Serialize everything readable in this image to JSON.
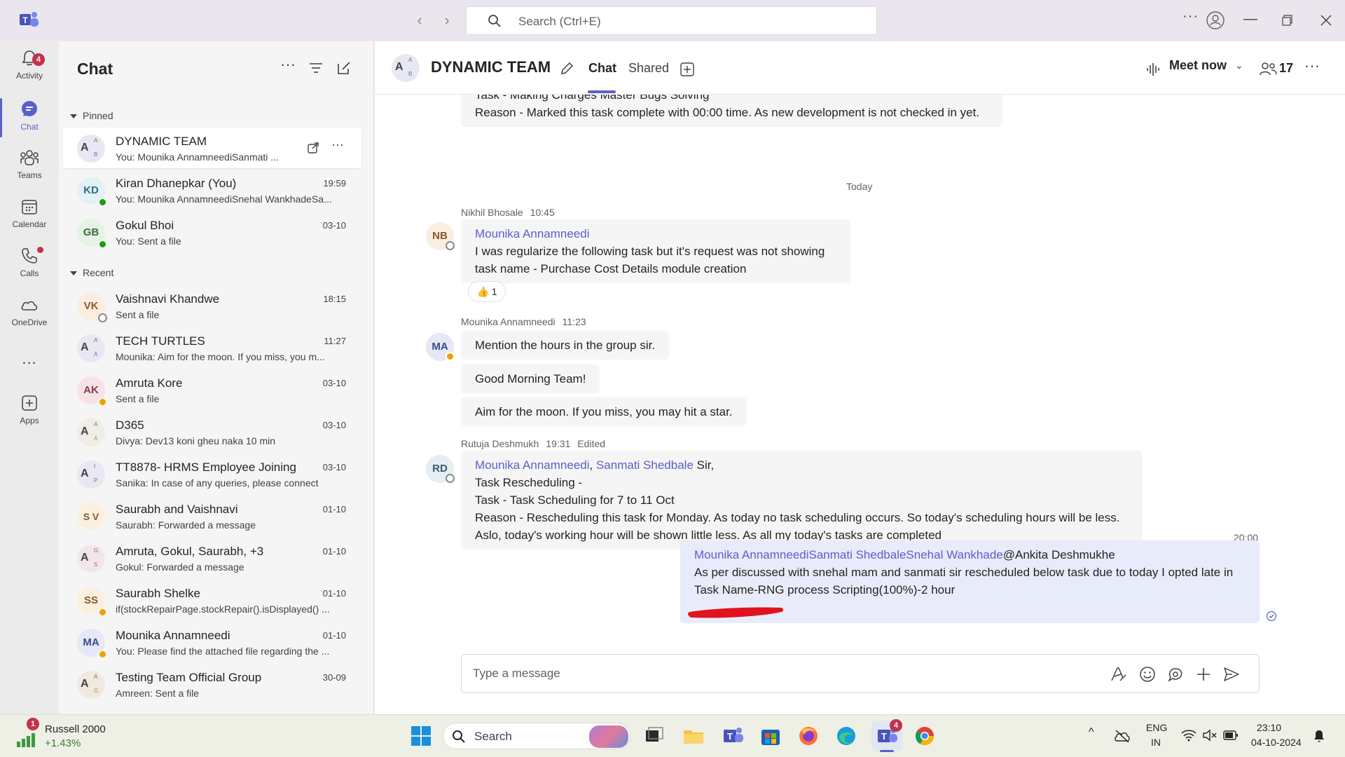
{
  "titlebar": {
    "search_placeholder": "Search (Ctrl+E)",
    "icons": [
      "teams-logo-icon",
      "back-icon",
      "forward-icon",
      "search-icon",
      "more-icon",
      "profile-icon",
      "minimize-icon",
      "maximize-icon",
      "close-icon"
    ]
  },
  "rail": {
    "items": [
      {
        "label": "Activity",
        "icon": "bell-icon",
        "badge": "4"
      },
      {
        "label": "Chat",
        "icon": "chat-icon"
      },
      {
        "label": "Teams",
        "icon": "teams-icon"
      },
      {
        "label": "Calendar",
        "icon": "calendar-icon"
      },
      {
        "label": "Calls",
        "icon": "phone-icon"
      },
      {
        "label": "OneDrive",
        "icon": "cloud-icon"
      },
      {
        "label": "Apps",
        "icon": "add-app-icon"
      }
    ],
    "more": "..."
  },
  "chatlist": {
    "title": "Chat",
    "pinned_label": "Pinned",
    "recent_label": "Recent",
    "pinned": [
      {
        "name": "DYNAMIC TEAM",
        "preview": "You: Mounika AnnamneediSanmati ...",
        "time": "",
        "avatar": "A",
        "group": true
      },
      {
        "name": "Kiran Dhanepkar (You)",
        "preview": "You: Mounika AnnamneediSnehal WankhadeSa...",
        "time": "19:59",
        "avatar": "KD",
        "status": "green"
      },
      {
        "name": "Gokul Bhoi",
        "preview": "You: Sent a file",
        "time": "03-10",
        "avatar": "GB",
        "status": "green"
      }
    ],
    "recent": [
      {
        "name": "Vaishnavi Khandwe",
        "preview": "Sent a file",
        "time": "18:15",
        "avatar": "VK",
        "status": "away"
      },
      {
        "name": "TECH TURTLES",
        "preview": "Mounika: Aim for the moon. If you miss, you m...",
        "time": "11:27",
        "avatar": "A",
        "group": true
      },
      {
        "name": "Amruta Kore",
        "preview": "Sent a file",
        "time": "03-10",
        "avatar": "AK",
        "status": "yellow"
      },
      {
        "name": "D365",
        "preview": "Divya: Dev13 koni gheu naka 10 min",
        "time": "03-10",
        "avatar": "A",
        "group": true
      },
      {
        "name": "TT8878- HRMS Employee Joining",
        "preview": "Sanika: In case of any queries, please connect",
        "time": "03-10",
        "avatar": "A",
        "group": true
      },
      {
        "name": "Saurabh and Vaishnavi",
        "preview": "Saurabh: Forwarded a message",
        "time": "01-10",
        "avatar": "S V",
        "group": false
      },
      {
        "name": "Amruta, Gokul, Saurabh, +3",
        "preview": "Gokul: Forwarded a message",
        "time": "01-10",
        "avatar": "A",
        "group": true
      },
      {
        "name": "Saurabh Shelke",
        "preview": "if(stockRepairPage.stockRepair().isDisplayed() ...",
        "time": "01-10",
        "avatar": "SS",
        "status": "yellow"
      },
      {
        "name": "Mounika Annamneedi",
        "preview": "You: Please find the attached file regarding the ...",
        "time": "01-10",
        "avatar": "MA",
        "status": "yellow"
      },
      {
        "name": "Testing Team Official Group",
        "preview": "Amreen: Sent a file",
        "time": "30-09",
        "avatar": "A",
        "group": true
      }
    ]
  },
  "chat": {
    "title": "DYNAMIC TEAM",
    "tabs": [
      "Chat",
      "Shared"
    ],
    "meet_now": "Meet now",
    "participants": "17",
    "today_label": "Today",
    "top_partial": {
      "line1": "Task - Making Charges Master Bugs Solving",
      "line2": "Reason - Marked this task complete with 00:00 time. As new development is not checked in yet."
    },
    "msg1": {
      "author": "Nikhil Bhosale",
      "time": "10:45",
      "avatar": "NB",
      "mention": "Mounika Annamneedi",
      "line1": "I was regularize the following task but it's request was not showing",
      "line2": "task name - Purchase Cost Details module creation",
      "reaction_emoji": "👍",
      "reaction_count": "1"
    },
    "msg2": {
      "author": "Mounika Annamneedi",
      "time": "11:23",
      "avatar": "MA",
      "b1": "Mention the hours in the group sir.",
      "b2": "Good Morning Team!",
      "b3": "Aim for the moon. If you miss, you may hit a star."
    },
    "msg3": {
      "author": "Rutuja Deshmukh",
      "time": "19:31",
      "edited": "Edited",
      "avatar": "RD",
      "mention1": "Mounika Annamneedi",
      "sep": ", ",
      "mention2": "Sanmati Shedbale",
      "after": " Sir,",
      "line2": "Task Rescheduling -",
      "line3": "Task - Task Scheduling for 7 to 11 Oct",
      "line4": "Reason - Rescheduling this task for Monday. As today no task scheduling occurs. So today's scheduling hours will be less.",
      "line5": "Aslo, today's working hour will be shown little less. As all my today's tasks are completed"
    },
    "msg4": {
      "time": "20:00",
      "mention": "Mounika AnnamneediSanmati ShedbaleSnehal Wankhade",
      "plain": "@Ankita Deshmukhe",
      "line2": "As per discussed with snehal mam and sanmati sir rescheduled below task due to today I opted late in",
      "line3": "Task Name-RNG process Scripting(100%)-2 hour"
    },
    "compose_placeholder": "Type a message"
  },
  "taskbar": {
    "ticker_name": "Russell 2000",
    "ticker_change": "+1.43%",
    "ticker_badge": "1",
    "search_label": "Search",
    "teams_badge": "4",
    "lang1": "ENG",
    "lang2": "IN",
    "clock_time": "23:10",
    "clock_date": "04-10-2024"
  },
  "colors": {
    "accent": "#5b5fc7",
    "mine_bubble": "#e8ebfa",
    "badge_red": "#c4314b",
    "annotation_red": "#e0141e"
  }
}
